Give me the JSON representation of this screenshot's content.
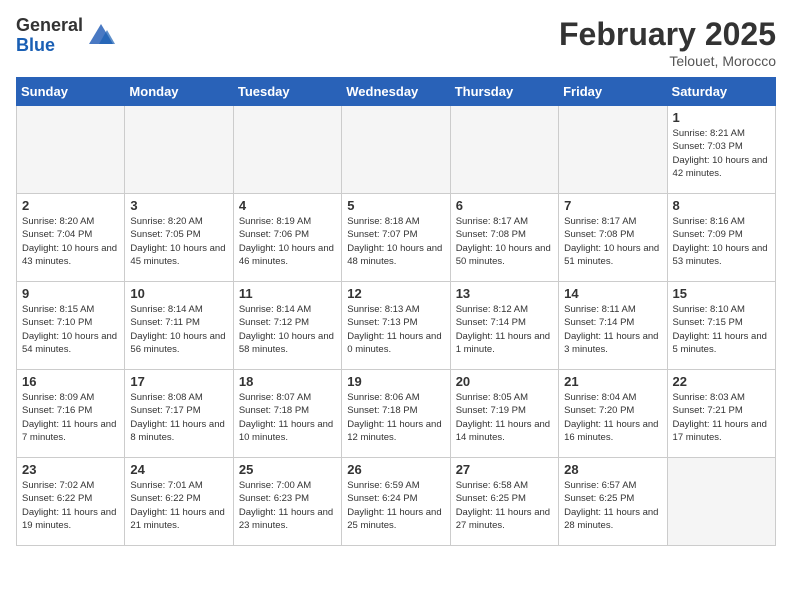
{
  "logo": {
    "general": "General",
    "blue": "Blue"
  },
  "header": {
    "month": "February 2025",
    "location": "Telouet, Morocco"
  },
  "weekdays": [
    "Sunday",
    "Monday",
    "Tuesday",
    "Wednesday",
    "Thursday",
    "Friday",
    "Saturday"
  ],
  "weeks": [
    [
      {
        "day": "",
        "info": ""
      },
      {
        "day": "",
        "info": ""
      },
      {
        "day": "",
        "info": ""
      },
      {
        "day": "",
        "info": ""
      },
      {
        "day": "",
        "info": ""
      },
      {
        "day": "",
        "info": ""
      },
      {
        "day": "1",
        "info": "Sunrise: 8:21 AM\nSunset: 7:03 PM\nDaylight: 10 hours\nand 42 minutes."
      }
    ],
    [
      {
        "day": "2",
        "info": "Sunrise: 8:20 AM\nSunset: 7:04 PM\nDaylight: 10 hours\nand 43 minutes."
      },
      {
        "day": "3",
        "info": "Sunrise: 8:20 AM\nSunset: 7:05 PM\nDaylight: 10 hours\nand 45 minutes."
      },
      {
        "day": "4",
        "info": "Sunrise: 8:19 AM\nSunset: 7:06 PM\nDaylight: 10 hours\nand 46 minutes."
      },
      {
        "day": "5",
        "info": "Sunrise: 8:18 AM\nSunset: 7:07 PM\nDaylight: 10 hours\nand 48 minutes."
      },
      {
        "day": "6",
        "info": "Sunrise: 8:17 AM\nSunset: 7:08 PM\nDaylight: 10 hours\nand 50 minutes."
      },
      {
        "day": "7",
        "info": "Sunrise: 8:17 AM\nSunset: 7:08 PM\nDaylight: 10 hours\nand 51 minutes."
      },
      {
        "day": "8",
        "info": "Sunrise: 8:16 AM\nSunset: 7:09 PM\nDaylight: 10 hours\nand 53 minutes."
      }
    ],
    [
      {
        "day": "9",
        "info": "Sunrise: 8:15 AM\nSunset: 7:10 PM\nDaylight: 10 hours\nand 54 minutes."
      },
      {
        "day": "10",
        "info": "Sunrise: 8:14 AM\nSunset: 7:11 PM\nDaylight: 10 hours\nand 56 minutes."
      },
      {
        "day": "11",
        "info": "Sunrise: 8:14 AM\nSunset: 7:12 PM\nDaylight: 10 hours\nand 58 minutes."
      },
      {
        "day": "12",
        "info": "Sunrise: 8:13 AM\nSunset: 7:13 PM\nDaylight: 11 hours\nand 0 minutes."
      },
      {
        "day": "13",
        "info": "Sunrise: 8:12 AM\nSunset: 7:14 PM\nDaylight: 11 hours\nand 1 minute."
      },
      {
        "day": "14",
        "info": "Sunrise: 8:11 AM\nSunset: 7:14 PM\nDaylight: 11 hours\nand 3 minutes."
      },
      {
        "day": "15",
        "info": "Sunrise: 8:10 AM\nSunset: 7:15 PM\nDaylight: 11 hours\nand 5 minutes."
      }
    ],
    [
      {
        "day": "16",
        "info": "Sunrise: 8:09 AM\nSunset: 7:16 PM\nDaylight: 11 hours\nand 7 minutes."
      },
      {
        "day": "17",
        "info": "Sunrise: 8:08 AM\nSunset: 7:17 PM\nDaylight: 11 hours\nand 8 minutes."
      },
      {
        "day": "18",
        "info": "Sunrise: 8:07 AM\nSunset: 7:18 PM\nDaylight: 11 hours\nand 10 minutes."
      },
      {
        "day": "19",
        "info": "Sunrise: 8:06 AM\nSunset: 7:18 PM\nDaylight: 11 hours\nand 12 minutes."
      },
      {
        "day": "20",
        "info": "Sunrise: 8:05 AM\nSunset: 7:19 PM\nDaylight: 11 hours\nand 14 minutes."
      },
      {
        "day": "21",
        "info": "Sunrise: 8:04 AM\nSunset: 7:20 PM\nDaylight: 11 hours\nand 16 minutes."
      },
      {
        "day": "22",
        "info": "Sunrise: 8:03 AM\nSunset: 7:21 PM\nDaylight: 11 hours\nand 17 minutes."
      }
    ],
    [
      {
        "day": "23",
        "info": "Sunrise: 7:02 AM\nSunset: 6:22 PM\nDaylight: 11 hours\nand 19 minutes."
      },
      {
        "day": "24",
        "info": "Sunrise: 7:01 AM\nSunset: 6:22 PM\nDaylight: 11 hours\nand 21 minutes."
      },
      {
        "day": "25",
        "info": "Sunrise: 7:00 AM\nSunset: 6:23 PM\nDaylight: 11 hours\nand 23 minutes."
      },
      {
        "day": "26",
        "info": "Sunrise: 6:59 AM\nSunset: 6:24 PM\nDaylight: 11 hours\nand 25 minutes."
      },
      {
        "day": "27",
        "info": "Sunrise: 6:58 AM\nSunset: 6:25 PM\nDaylight: 11 hours\nand 27 minutes."
      },
      {
        "day": "28",
        "info": "Sunrise: 6:57 AM\nSunset: 6:25 PM\nDaylight: 11 hours\nand 28 minutes."
      },
      {
        "day": "",
        "info": ""
      }
    ]
  ]
}
